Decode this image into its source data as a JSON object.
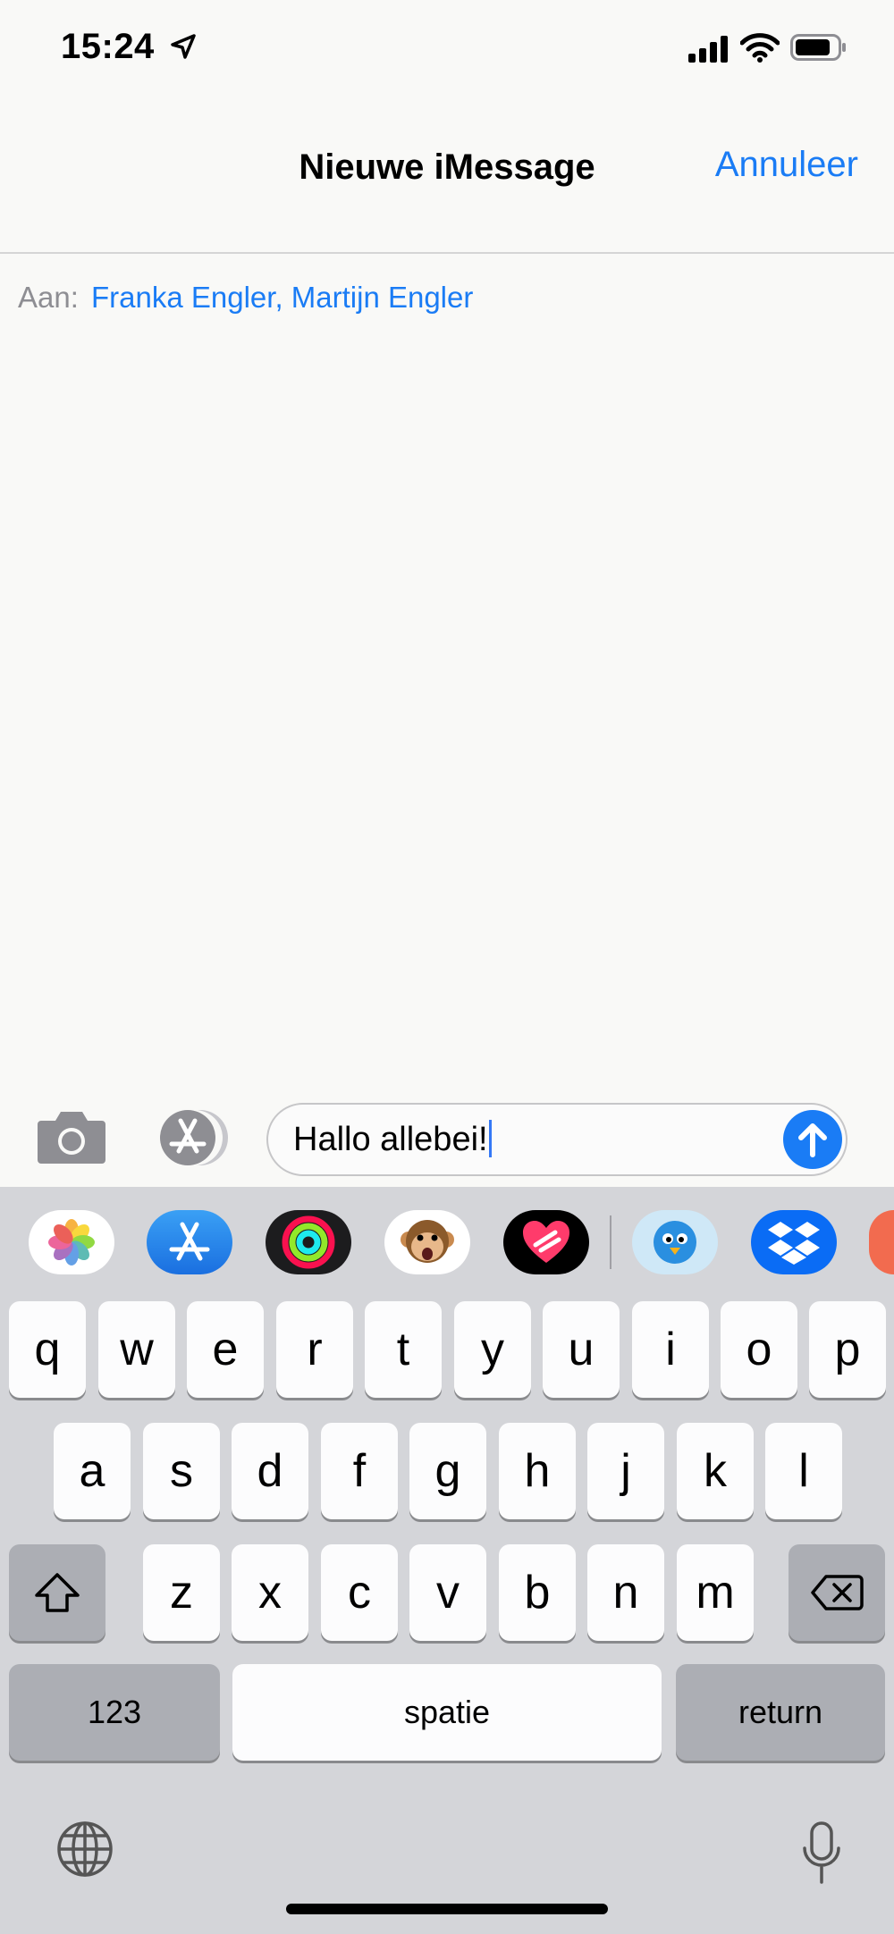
{
  "status_bar": {
    "time": "15:24"
  },
  "nav": {
    "title": "Nieuwe iMessage",
    "cancel_label": "Annuleer"
  },
  "to_field": {
    "label": "Aan:",
    "recipients": "Franka Engler, Martijn Engler"
  },
  "compose": {
    "message_text": "Hallo allebei!"
  },
  "app_strip": {
    "apps": [
      "photos-icon",
      "app-store-icon",
      "activity-icon",
      "animoji-icon",
      "heart-app-icon",
      "twitterrific-icon",
      "dropbox-icon",
      "partial-app-icon"
    ]
  },
  "keyboard": {
    "row1": [
      "q",
      "w",
      "e",
      "r",
      "t",
      "y",
      "u",
      "i",
      "o",
      "p"
    ],
    "row2": [
      "a",
      "s",
      "d",
      "f",
      "g",
      "h",
      "j",
      "k",
      "l"
    ],
    "row3": [
      "z",
      "x",
      "c",
      "v",
      "b",
      "n",
      "m"
    ],
    "numbers_label": "123",
    "space_label": "spatie",
    "return_label": "return"
  },
  "colors": {
    "accent": "#1a7cf5",
    "background": "#f9f9f7",
    "keyboard": "#d4d5d9"
  }
}
